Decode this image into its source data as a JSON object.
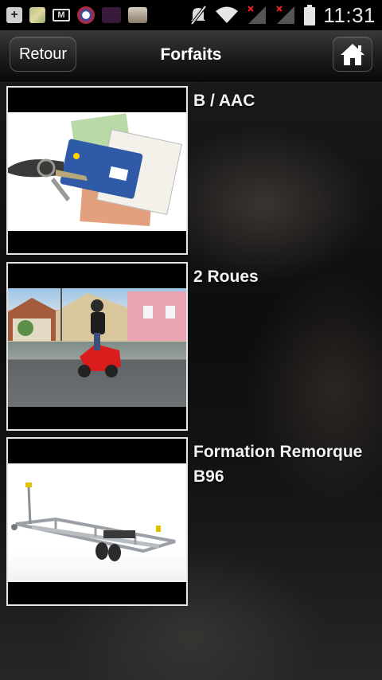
{
  "status_bar": {
    "time": "11:31",
    "icons": [
      "add-icon",
      "map-app-icon",
      "gmail-icon",
      "enpc-app-icon",
      "media-app-icon",
      "photo-app-icon",
      "mute-icon",
      "wifi-icon",
      "signal-icon",
      "signal-icon",
      "battery-icon"
    ]
  },
  "header": {
    "back_label": "Retour",
    "title": "Forfaits",
    "home_icon": "home-icon"
  },
  "items": [
    {
      "label": "B / AAC",
      "image": "permis-de-conduire-photo"
    },
    {
      "label": "2 Roues",
      "image": "scooter-photo"
    },
    {
      "label": "Formation Remorque B96",
      "image": "remorque-photo"
    }
  ],
  "colors": {
    "header_bg": "#1b1b1b",
    "thumb_border": "#e6e6e6",
    "text": "#ffffff"
  }
}
